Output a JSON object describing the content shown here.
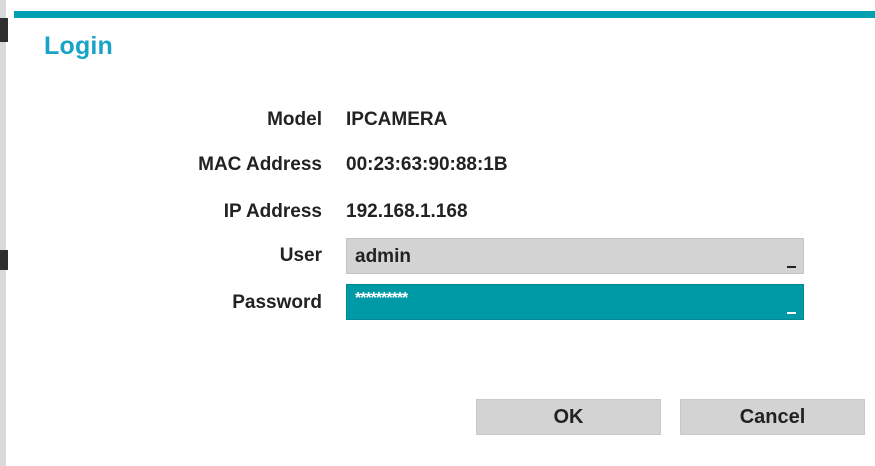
{
  "dialog": {
    "title": "Login",
    "accent_color": "#1aa3c9"
  },
  "info": {
    "model_label": "Model",
    "model_value": "IPCAMERA",
    "mac_label": "MAC Address",
    "mac_value": "00:23:63:90:88:1B",
    "ip_label": "IP Address",
    "ip_value": "192.168.1.168"
  },
  "form": {
    "user_label": "User",
    "user_value": "admin",
    "password_label": "Password",
    "password_value": "**********"
  },
  "buttons": {
    "ok_label": "OK",
    "cancel_label": "Cancel"
  }
}
